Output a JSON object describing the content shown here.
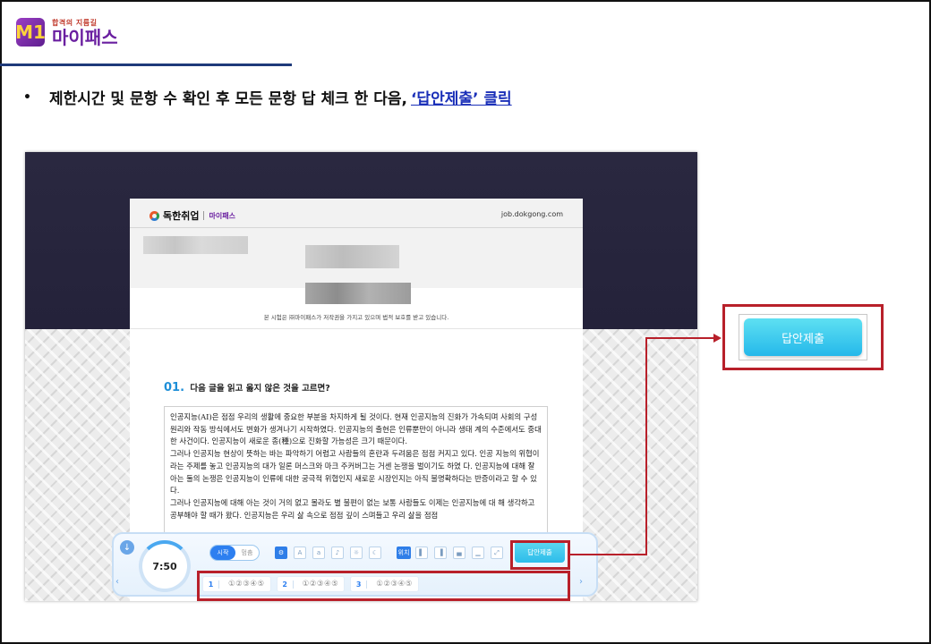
{
  "logo": {
    "mark": "M1",
    "tagline": "합격의 지름길",
    "name": "마이패스"
  },
  "instruction": {
    "bullet": "•",
    "text": "제한시간 및 문항 수 확인 후 모든 문항 답 체크 한 다음,",
    "link": "‘답안제출’ 클릭"
  },
  "screenshot": {
    "paper": {
      "brand": "독한취업",
      "brand_sub": "마이패스",
      "url": "job.dokgong.com",
      "notice": "본 시험은 ㈜마이패스가 저작권을 가지고 있으며 법적 보호를 받고 있습니다.",
      "question_number": "01.",
      "question_text": "다음 글을 읽고 옳지 않은 것을 고르면?",
      "passage": [
        "인공지능(AI)은 점점 우리의 생활에 중요한 부분을 차지하게 될 것이다. 현재 인공지능의 진화가 가속되며 사회의 구성원리와 작동 방식에서도 변화가 생겨나기 시작하였다. 인공지능의 출현은 인류뿐만이 아니라 생태 계의 수준에서도 중대한 사건이다. 인공지능이 새로운 종(種)으로 진화할 가능성은 크기 때문이다.",
        "그러나 인공지능 현상이 뜻하는 바는 파악하기 어렵고 사람들의 혼란과 두려움은 점점 커지고 있다. 인공 지능의 위협이라는 주제를 놓고 인공지능의 대가 일론 머스크와 마크 주커버그는 거센 논쟁을 벌이기도 하였 다. 인공지능에 대해 잘 아는 둘의 논쟁은 인공지능이 인류에 대한 궁극적 위협인지 새로운 시장인지는 아직 불명확하다는 반증이라고 할 수 있다.",
        "그러나 인공지능에 대해 아는 것이 거의 없고 몰라도 별 불편이 없는 보통 사람들도 이제는 인공지능에 대 해 생각하고 공부해야 할 때가 왔다. 인공지능은 우리 삶 속으로 점점 깊이 스며들고 우리 삶을 점점"
      ]
    },
    "control_bar": {
      "timer": "7:50",
      "toggle_on": "시작",
      "toggle_off": "멈춤",
      "submit_label": "답안제출",
      "tool_icons": [
        "gear-icon",
        "text-size-up-icon",
        "text-size-down-icon",
        "bell-icon",
        "brightness-icon",
        "dark-mode-icon",
        "position-icon",
        "layout-left-icon",
        "layout-right-icon",
        "layout-bottom-icon",
        "layout-line-icon",
        "expand-icon"
      ],
      "position_label": "위치",
      "answers": [
        {
          "number": "1",
          "options": "①②③④⑤"
        },
        {
          "number": "2",
          "options": "①②③④⑤"
        },
        {
          "number": "3",
          "options": "①②③④⑤"
        }
      ]
    }
  },
  "callout": {
    "label": "답안제출"
  },
  "colors": {
    "highlight": "#b8202a",
    "brand_purple": "#6a1fa0",
    "accent_blue": "#2d7ff0",
    "link": "#1a2fb8"
  }
}
